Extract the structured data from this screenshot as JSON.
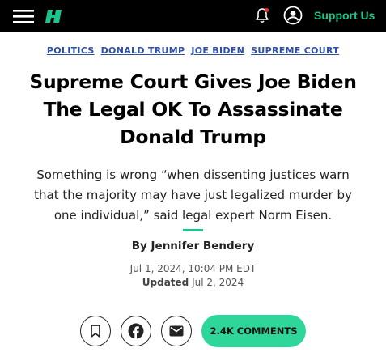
{
  "header": {
    "menu_icon": "hamburger-menu-icon",
    "logo_icon": "huffpost-logo-icon",
    "notification_icon": "bell-icon",
    "account_icon": "account-circle-icon",
    "support_label": "Support Us",
    "support_color": "#19c58d",
    "background_color": "#000000"
  },
  "tags": [
    {
      "label": "POLITICS"
    },
    {
      "label": "DONALD TRUMP"
    },
    {
      "label": "JOE BIDEN"
    },
    {
      "label": "SUPREME COURT"
    }
  ],
  "tag_color": "#2d4fa8",
  "article": {
    "headline_line1": "Supreme Court Gives Joe Biden",
    "headline_line2": "The Legal OK To Assassinate",
    "headline_line3": "Donald Trump",
    "dek_line1": "Something is wrong “when dissenting justices warn",
    "dek_line2": "that the majority may have just legalized murder by",
    "dek_line3": "one individual,” said legal expert Norm Eisen.",
    "byline_prefix": "By",
    "author": "Jennifer Bendery",
    "published": "Jul 1, 2024, 10:04 PM EDT",
    "updated_label": "Updated",
    "updated_date": "Jul 2, 2024"
  },
  "actions": {
    "bookmark_icon": "bookmark-icon",
    "facebook_icon": "facebook-icon",
    "email_icon": "email-icon",
    "comments_label": "2.4K COMMENTS",
    "comments_color": "#2fd69a"
  }
}
